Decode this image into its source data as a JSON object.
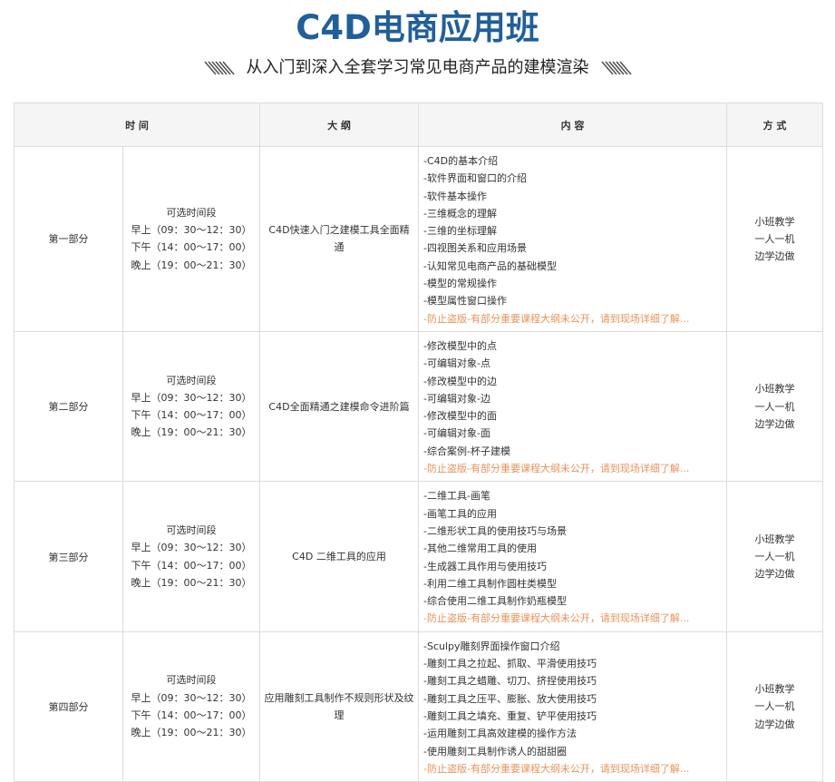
{
  "header": {
    "title": "C4D电商应用班",
    "subtitle": "从入门到深入全套学习常见电商产品的建模渲染"
  },
  "table": {
    "columns": [
      "时 间",
      "大 纲",
      "内 容",
      "方 式"
    ],
    "rows": [
      {
        "part": "第一部分",
        "times": [
          "可选时间段",
          "早上（09：30～12：30）",
          "下午（14：00～17：00）",
          "晚上（19：00～21：30）"
        ],
        "outline": "C4D快速入门之建模工具全面精通",
        "items": [
          "-C4D的基本介绍",
          "-软件界面和窗口的介绍",
          "-软件基本操作",
          "-三维概念的理解",
          "-三维的坐标理解",
          "-四视图关系和应用场景",
          "-认知常见电商产品的基础模型",
          "-模型的常规操作",
          "-模型属性窗口操作"
        ],
        "note": "-防止盗版-有部分重要课程大纲未公开，请到现场详细了解...",
        "mode": [
          "小班教学",
          "一人一机",
          "边学边做"
        ]
      },
      {
        "part": "第二部分",
        "times": [
          "可选时间段",
          "早上（09：30～12：30）",
          "下午（14：00～17：00）",
          "晚上（19：00～21：30）"
        ],
        "outline": "C4D全面精通之建模命令进阶篇",
        "items": [
          "-修改模型中的点",
          "-可编辑对象-点",
          "-修改模型中的边",
          "-可编辑对象-边",
          "-修改模型中的面",
          "-可编辑对象-面",
          "-综合案例-杯子建模"
        ],
        "note": "-防止盗版-有部分重要课程大纲未公开，请到现场详细了解...",
        "mode": [
          "小班教学",
          "一人一机",
          "边学边做"
        ]
      },
      {
        "part": "第三部分",
        "times": [
          "可选时间段",
          "早上（09：30～12：30）",
          "下午（14：00～17：00）",
          "晚上（19：00～21：30）"
        ],
        "outline": "C4D 二维工具的应用",
        "items": [
          "-二维工具-画笔",
          "-画笔工具的应用",
          "-二维形状工具的使用技巧与场景",
          "-其他二维常用工具的使用",
          "-生成器工具作用与使用技巧",
          "-利用二维工具制作圆柱类模型",
          "-综合使用二维工具制作奶瓶模型"
        ],
        "note": "-防止盗版-有部分重要课程大纲未公开，请到现场详细了解...",
        "mode": [
          "小班教学",
          "一人一机",
          "边学边做"
        ]
      },
      {
        "part": "第四部分",
        "times": [
          "可选时间段",
          "早上（09：30～12：30）",
          "下午（14：00～17：00）",
          "晚上（19：00～21：30）"
        ],
        "outline": "应用雕刻工具制作不规则形状及纹理",
        "items": [
          "-Sculpy雕刻界面操作窗口介绍",
          "-雕刻工具之拉起、抓取、平滑使用技巧",
          "-雕刻工具之蜡雕、切刀、挤捏使用技巧",
          "-雕刻工具之压平、膨胀、放大使用技巧",
          "-雕刻工具之填充、重复、铲平使用技巧",
          "-运用雕刻工具高效建模的操作方法",
          "-使用雕刻工具制作诱人的甜甜圈"
        ],
        "note": "-防止盗版-有部分重要课程大纲未公开，请到现场详细了解...",
        "mode": [
          "小班教学",
          "一人一机",
          "边学边做"
        ]
      }
    ]
  }
}
